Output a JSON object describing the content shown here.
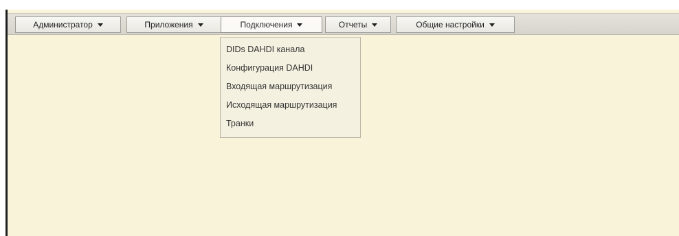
{
  "menubar": {
    "items": [
      {
        "label": "Администратор",
        "icon": "chevron-down-icon"
      },
      {
        "label": "Приложения",
        "icon": "chevron-down-icon"
      },
      {
        "label": "Подключения",
        "icon": "chevron-down-icon",
        "active": true
      },
      {
        "label": "Отчеты",
        "icon": "chevron-down-icon"
      },
      {
        "label": "Общие настройки",
        "icon": "chevron-down-icon"
      }
    ]
  },
  "dropdown": {
    "items": [
      {
        "label": "DIDs DAHDI канала"
      },
      {
        "label": "Конфигурация DAHDI"
      },
      {
        "label": "Входящая маршрутизация"
      },
      {
        "label": "Исходящая маршрутизация"
      },
      {
        "label": "Транки"
      }
    ]
  },
  "colors": {
    "content_background": "#f8f3d9",
    "menubar_background": "#dcdad1",
    "dropdown_background": "#f5f1e0",
    "left_border": "#1e1e1e"
  }
}
